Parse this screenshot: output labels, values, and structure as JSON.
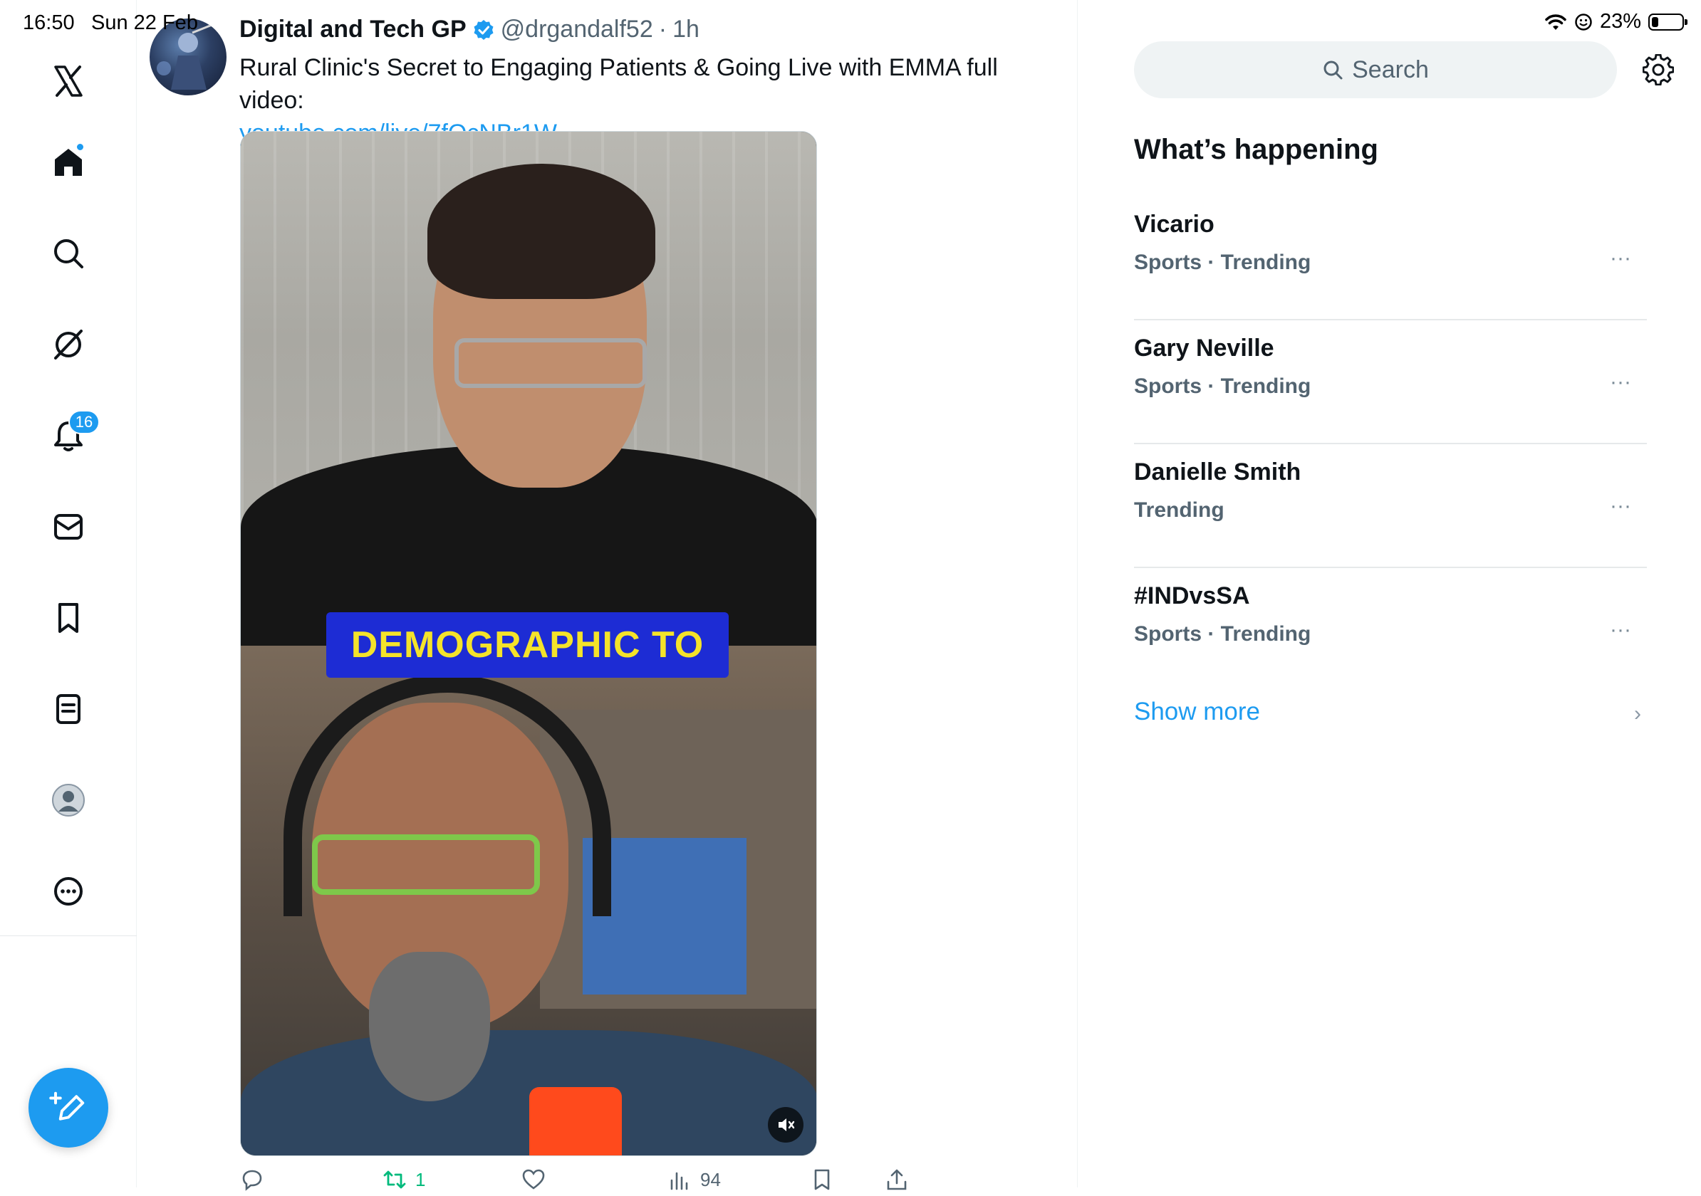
{
  "status_bar": {
    "time": "16:50",
    "date": "Sun 22 Feb",
    "battery": "23%",
    "battery_level": 0.23
  },
  "sidebar": {
    "notifications_badge": "16",
    "items": [
      {
        "name": "x-logo",
        "icon": "x-logo-icon"
      },
      {
        "name": "home",
        "icon": "home-icon",
        "has_dot": true
      },
      {
        "name": "explore",
        "icon": "search-icon"
      },
      {
        "name": "grok",
        "icon": "grok-icon"
      },
      {
        "name": "notifications",
        "icon": "bell-icon"
      },
      {
        "name": "messages",
        "icon": "mail-icon"
      },
      {
        "name": "bookmarks",
        "icon": "bookmark-icon"
      },
      {
        "name": "lists",
        "icon": "list-icon"
      },
      {
        "name": "profile",
        "icon": "avatar-icon"
      },
      {
        "name": "more",
        "icon": "more-circle-icon"
      }
    ],
    "compose_icon": "compose-icon"
  },
  "tweet": {
    "author_name": "Digital and Tech GP",
    "verified": true,
    "handle": "@drgandalf52",
    "separator": "·",
    "time": "1h",
    "text": "Rural Clinic's Secret to Engaging Patients & Going Live with EMMA full video:",
    "link": "youtube.com/live/7fOcNBr1W...",
    "video_caption": "DEMOGRAPHIC TO",
    "actions": {
      "reply_count": "",
      "retweet_count": "1",
      "like_count": "",
      "views_count": "94"
    }
  },
  "right_panel": {
    "search_placeholder": "Search",
    "section_title": "What’s happening",
    "trends": [
      {
        "name": "Vicario",
        "meta": "Sports · Trending"
      },
      {
        "name": "Gary Neville",
        "meta": "Sports · Trending"
      },
      {
        "name": "Danielle Smith",
        "meta": "Trending"
      },
      {
        "name": "#INDvsSA",
        "meta": "Sports · Trending"
      }
    ],
    "more_glyph": "···",
    "show_more": "Show more",
    "chevron": "›"
  },
  "colors": {
    "accent": "#1d9bf0",
    "text_primary": "#0f1419",
    "text_secondary": "#536471",
    "retweet_green": "#00ba7c",
    "caption_bg": "#1d2cd4",
    "caption_text": "#f4e32a"
  }
}
